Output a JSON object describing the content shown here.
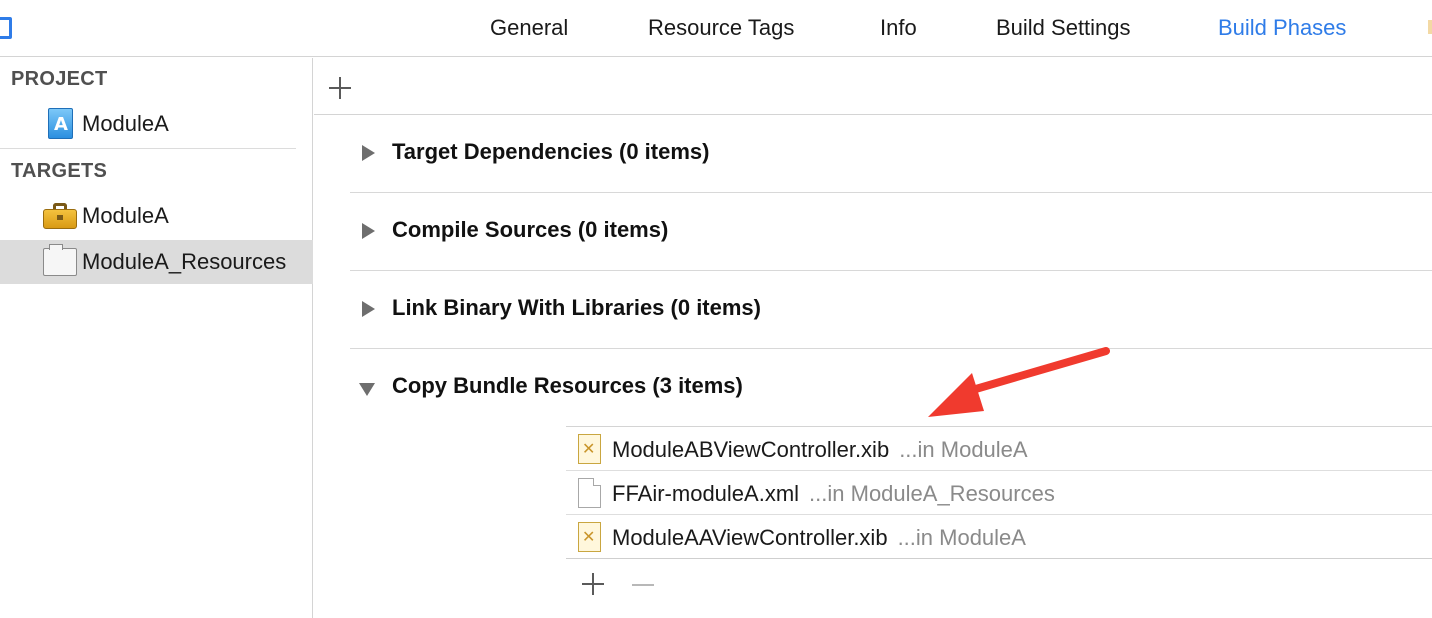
{
  "tabs": [
    {
      "label": "General"
    },
    {
      "label": "Resource Tags"
    },
    {
      "label": "Info"
    },
    {
      "label": "Build Settings"
    },
    {
      "label": "Build Phases",
      "active": true
    }
  ],
  "colors": {
    "accent": "#2f7ce8",
    "selection": "#dcdcdc",
    "annotation_arrow": "#f03a2e"
  },
  "sidebar": {
    "project_header": "PROJECT",
    "project_items": [
      {
        "label": "ModuleA",
        "icon": "xcodeproj-icon"
      }
    ],
    "targets_header": "TARGETS",
    "target_items": [
      {
        "label": "ModuleA",
        "icon": "toolbox-icon"
      },
      {
        "label": "ModuleA_Resources",
        "icon": "bundle-icon",
        "selected": true
      }
    ]
  },
  "main": {
    "phases": [
      {
        "title": "Target Dependencies (0 items)",
        "expanded": false
      },
      {
        "title": "Compile Sources (0 items)",
        "expanded": false
      },
      {
        "title": "Link Binary With Libraries (0 items)",
        "expanded": false
      },
      {
        "title": "Copy Bundle Resources (3 items)",
        "expanded": true
      }
    ],
    "resources": [
      {
        "name": "ModuleABViewController.xib",
        "location": "...in ModuleA",
        "icon": "xib-file-icon"
      },
      {
        "name": "FFAir-moduleA.xml",
        "location": "...in ModuleA_Resources",
        "icon": "xml-file-icon"
      },
      {
        "name": "ModuleAAViewController.xib",
        "location": "...in ModuleA",
        "icon": "xib-file-icon"
      }
    ]
  }
}
